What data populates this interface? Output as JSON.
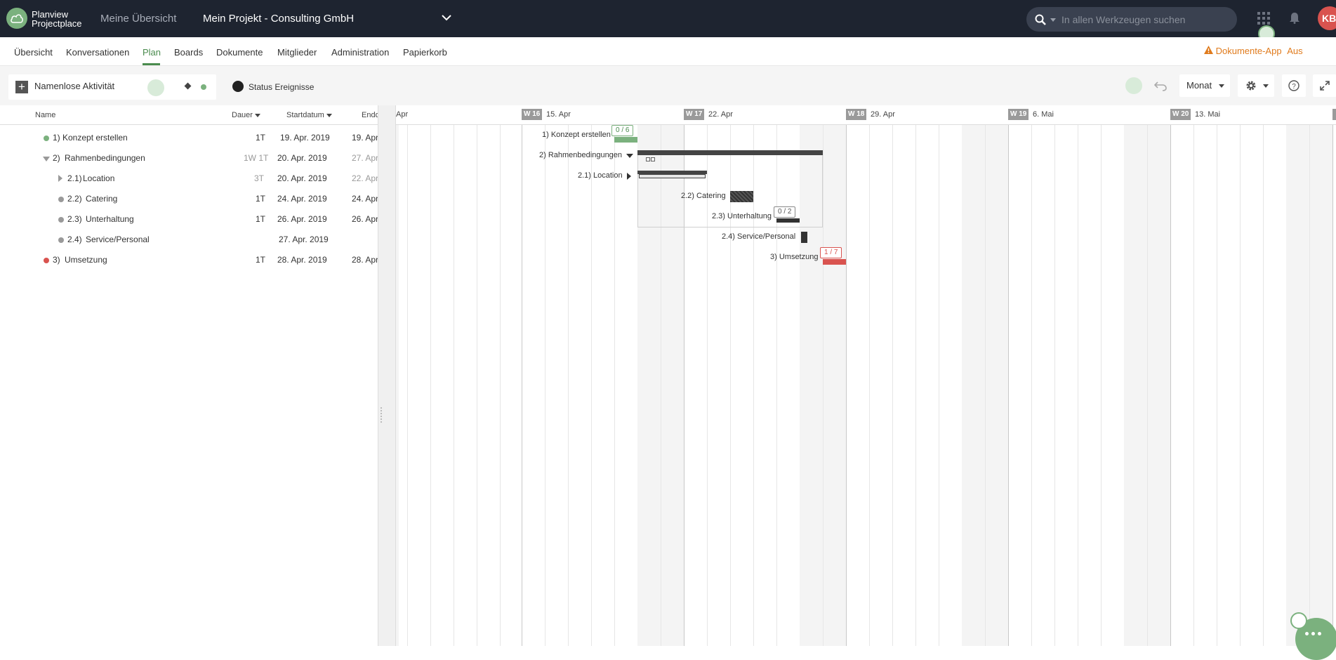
{
  "app": {
    "brand_line1": "Planview",
    "brand_line2": "Projectplace",
    "overview_link": "Meine Übersicht",
    "project_title": "Mein Projekt - Consulting GmbH",
    "search_placeholder": "In allen Werkzeugen suchen",
    "avatar_initials": "KB"
  },
  "nav": {
    "items": [
      "Übersicht",
      "Konversationen",
      "Plan",
      "Boards",
      "Dokumente",
      "Mitglieder",
      "Administration",
      "Papierkorb"
    ],
    "active": "Plan",
    "warning_label": "Dokumente-App",
    "warning_state": "Aus"
  },
  "toolbar": {
    "new_activity": "Namenlose Aktivität",
    "status_events": "Status Ereignisse",
    "zoom": "Monat"
  },
  "columns": {
    "name": "Name",
    "duration": "Dauer",
    "start": "Startdatum",
    "end": "Enddatum"
  },
  "timeline": {
    "partial_label": "Apr",
    "weeks": [
      {
        "week": "W 16",
        "date": "15. Apr"
      },
      {
        "week": "W 17",
        "date": "22. Apr"
      },
      {
        "week": "W 18",
        "date": "29. Apr"
      },
      {
        "week": "W 19",
        "date": "6. Mai"
      },
      {
        "week": "W 20",
        "date": "13. Mai"
      }
    ]
  },
  "rows": [
    {
      "num": "1)",
      "name": "Konzept erstellen",
      "duration": "1T",
      "start": "19. Apr. 2019",
      "end": "19. Apr.",
      "status_color": "#7bb17e",
      "gantt_label": "1) Konzept erstellen",
      "badge": "0 / 6"
    },
    {
      "num": "2)",
      "name": "Rahmenbedingungen",
      "duration": "1W 1T",
      "start": "20. Apr. 2019",
      "end": "27. Apr.",
      "gantt_label": "2) Rahmenbedingungen"
    },
    {
      "num": "2.1)",
      "name": "Location",
      "duration": "3T",
      "start": "20. Apr. 2019",
      "end": "22. Apr.",
      "gantt_label": "2.1) Location"
    },
    {
      "num": "2.2)",
      "name": "Catering",
      "duration": "1T",
      "start": "24. Apr. 2019",
      "end": "24. Apr.",
      "status_color": "#999999",
      "gantt_label": "2.2) Catering"
    },
    {
      "num": "2.3)",
      "name": "Unterhaltung",
      "duration": "1T",
      "start": "26. Apr. 2019",
      "end": "26. Apr.",
      "status_color": "#999999",
      "gantt_label": "2.3) Unterhaltung",
      "badge": "0 / 2"
    },
    {
      "num": "2.4)",
      "name": "Service/Personal",
      "duration": "",
      "start": "27. Apr. 2019",
      "end": "",
      "status_color": "#999999",
      "gantt_label": "2.4) Service/Personal"
    },
    {
      "num": "3)",
      "name": "Umsetzung",
      "duration": "1T",
      "start": "28. Apr. 2019",
      "end": "28. Apr.",
      "status_color": "#d9534f",
      "gantt_label": "3) Umsetzung",
      "badge": "1 / 7"
    }
  ],
  "icons": {
    "logo": "cloud-logo-icon",
    "search": "search-icon",
    "apps": "apps-grid-icon",
    "bell": "bell-icon",
    "warning": "warning-icon",
    "undo": "undo-icon",
    "settings": "gear-icon",
    "help": "help-icon",
    "fullscreen": "expand-icon",
    "chat": "chat-icon"
  },
  "colors": {
    "topbar": "#1e2430",
    "accent": "#4a8b4e",
    "green": "#7bb17e",
    "red": "#d9534f",
    "warning": "#e07b1d"
  }
}
